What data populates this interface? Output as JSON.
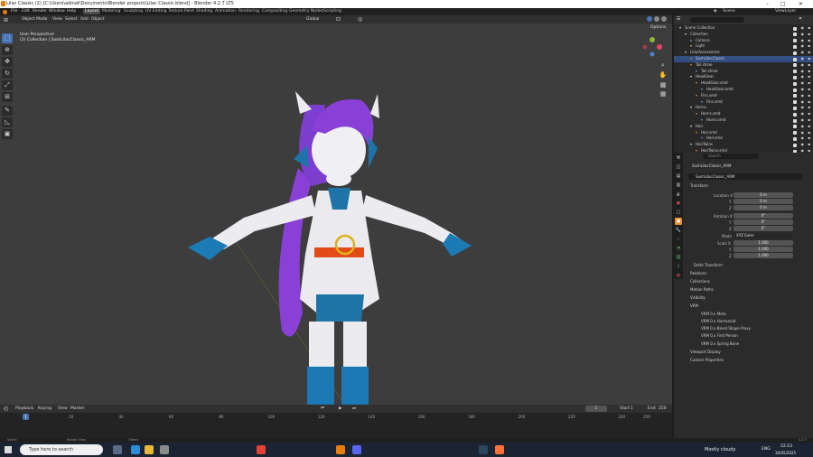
{
  "window": {
    "title": "Lilac Classic (2) [C:\\Users\\adinat\\Documents\\Blender projects\\Lilac Classic.blend] - Blender 4.2.7 LTS"
  },
  "menu": {
    "items": [
      "File",
      "Edit",
      "Render",
      "Window",
      "Help"
    ]
  },
  "workspaces": [
    "Layout",
    "Modeling",
    "Sculpting",
    "UV Editing",
    "Texture Paint",
    "Shading",
    "Animation",
    "Rendering",
    "Compositing",
    "Geometry Nodes",
    "Scripting"
  ],
  "active_workspace": "Layout",
  "scene": {
    "label": "Scene",
    "view_layer": "ViewLayer"
  },
  "viewport_header": {
    "mode": "Object Mode",
    "menus": [
      "View",
      "Select",
      "Add",
      "Object"
    ],
    "orientation": "Global",
    "options": "Options"
  },
  "viewport_info": {
    "line1": "User Perspective",
    "line2": "(2) Collection | SashLilacClassic_ARM"
  },
  "outliner": {
    "search_placeholder": "",
    "rows": [
      {
        "name": "Scene Collection",
        "indent": 0
      },
      {
        "name": "Collection",
        "indent": 1
      },
      {
        "name": "Camera",
        "indent": 2
      },
      {
        "name": "Light",
        "indent": 2
      },
      {
        "name": "LilacAccessories",
        "indent": 1
      },
      {
        "name": "SashLilacClassic",
        "indent": 2
      },
      {
        "name": "Tail.shine",
        "indent": 2
      },
      {
        "name": "Tail.shine",
        "indent": 3
      },
      {
        "name": "HeadGear",
        "indent": 2
      },
      {
        "name": "HeadGear.smd",
        "indent": 3
      },
      {
        "name": "HeadGear.smd",
        "indent": 4
      },
      {
        "name": "Fins.smd",
        "indent": 3
      },
      {
        "name": "Fins.smd",
        "indent": 4
      },
      {
        "name": "Horns",
        "indent": 2
      },
      {
        "name": "Horns.smd",
        "indent": 3
      },
      {
        "name": "Horns.smd",
        "indent": 4
      },
      {
        "name": "Hair",
        "indent": 2
      },
      {
        "name": "Hair.smd",
        "indent": 3
      },
      {
        "name": "Hair.smd",
        "indent": 4
      },
      {
        "name": "HairTwins",
        "indent": 2
      },
      {
        "name": "HairTwins.smd",
        "indent": 3
      }
    ]
  },
  "properties": {
    "search_placeholder": "Search",
    "object_path": "SashLilacClassic_ARM",
    "object_name": "SashLilacClassic_ARM",
    "transform_label": "Transform",
    "location": {
      "label": "Location X",
      "x": "0 m",
      "y": "0 m",
      "z": "0 m"
    },
    "rotation": {
      "label": "Rotation X",
      "x": "0°",
      "y": "0°",
      "z": "0°"
    },
    "mode_label": "Mode",
    "mode": "XYZ Euler",
    "scale": {
      "label": "Scale X",
      "x": "1.000",
      "y": "1.000",
      "z": "1.000"
    },
    "axis": {
      "y": "Y",
      "z": "Z"
    },
    "delta": "Delta Transform",
    "sections": [
      "Relations",
      "Collections",
      "Motion Paths",
      "Visibility"
    ],
    "vrm": {
      "label": "VRM",
      "items": [
        "VRM 0.x Meta",
        "VRM 0.x Humanoid",
        "VRM 0.x Blend Shape Proxy",
        "VRM 0.x First Person",
        "VRM 0.x Spring Bone"
      ]
    },
    "after": [
      "Viewport Display",
      "Custom Properties"
    ]
  },
  "timeline": {
    "menus": [
      "Playback",
      "Keying",
      "View",
      "Marker"
    ],
    "current_frame": "1",
    "start_label": "Start",
    "start": "1",
    "end_label": "End",
    "end": "250",
    "ticks": [
      "1",
      "20",
      "40",
      "60",
      "80",
      "100",
      "120",
      "140",
      "160",
      "180",
      "200",
      "220",
      "240",
      "250"
    ]
  },
  "status": {
    "left": "Select",
    "mid": "Rotate View",
    "right": "Object",
    "version": "4.2.7"
  },
  "taskbar": {
    "search_placeholder": "Type here to search",
    "weather": "Mostly cloudy",
    "lang": "ENG",
    "time": "22:23",
    "date": "30/05/2025"
  },
  "colors": {
    "accent": "#4772b3",
    "viewport": "#3d3d3d",
    "header": "#303030",
    "selection": "#334d80"
  }
}
